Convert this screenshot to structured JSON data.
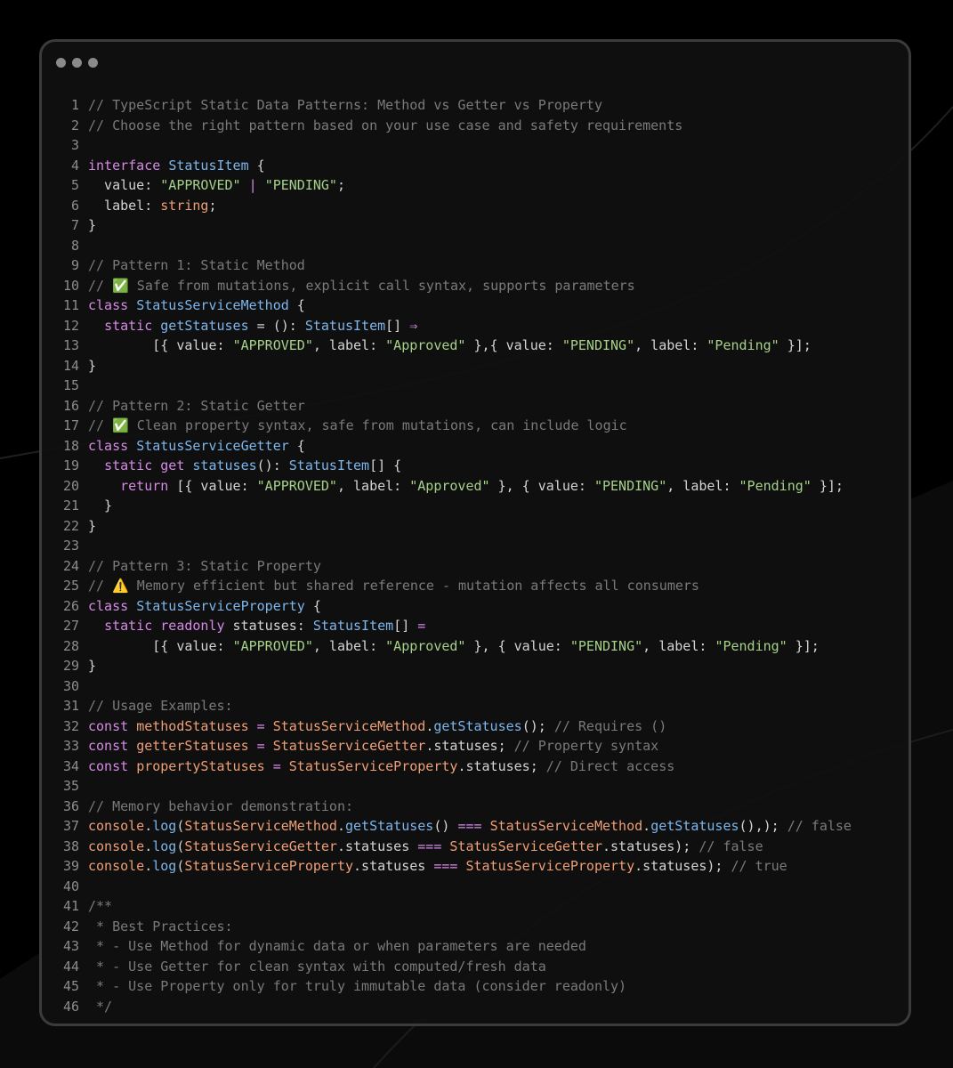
{
  "window": {
    "controls": [
      "close",
      "minimize",
      "maximize"
    ]
  },
  "colors": {
    "comment": "#7a7a7a",
    "keyword": "#d68ae6",
    "type": "#7cb6ec",
    "string": "#a6d189",
    "variable": "#ef9f76",
    "text": "#d4d4d4"
  },
  "code": {
    "lines": [
      {
        "n": "1",
        "t": [
          [
            "comment",
            "// TypeScript Static Data Patterns: Method vs Getter vs Property"
          ]
        ]
      },
      {
        "n": "2",
        "t": [
          [
            "comment",
            "// Choose the right pattern based on your use case and safety requirements"
          ]
        ]
      },
      {
        "n": "3",
        "t": []
      },
      {
        "n": "4",
        "t": [
          [
            "kw",
            "interface"
          ],
          [
            "punc",
            " "
          ],
          [
            "type",
            "StatusItem"
          ],
          [
            "punc",
            " {"
          ]
        ]
      },
      {
        "n": "5",
        "t": [
          [
            "punc",
            "  value: "
          ],
          [
            "str",
            "\"APPROVED\""
          ],
          [
            "punc",
            " "
          ],
          [
            "op",
            "|"
          ],
          [
            "punc",
            " "
          ],
          [
            "str",
            "\"PENDING\""
          ],
          [
            "punc",
            ";"
          ]
        ]
      },
      {
        "n": "6",
        "t": [
          [
            "punc",
            "  label: "
          ],
          [
            "var",
            "string"
          ],
          [
            "punc",
            ";"
          ]
        ]
      },
      {
        "n": "7",
        "t": [
          [
            "punc",
            "}"
          ]
        ]
      },
      {
        "n": "8",
        "t": []
      },
      {
        "n": "9",
        "t": [
          [
            "comment",
            "// Pattern 1: Static Method"
          ]
        ]
      },
      {
        "n": "10",
        "t": [
          [
            "comment",
            "// ✅ Safe from mutations, explicit call syntax, supports parameters"
          ]
        ]
      },
      {
        "n": "11",
        "t": [
          [
            "kw",
            "class"
          ],
          [
            "punc",
            " "
          ],
          [
            "type",
            "StatusServiceMethod"
          ],
          [
            "punc",
            " {"
          ]
        ]
      },
      {
        "n": "12",
        "t": [
          [
            "punc",
            "  "
          ],
          [
            "kw",
            "static"
          ],
          [
            "punc",
            " "
          ],
          [
            "fn",
            "getStatuses"
          ],
          [
            "punc",
            " = (): "
          ],
          [
            "type",
            "StatusItem"
          ],
          [
            "punc",
            "[] "
          ],
          [
            "op",
            "⇒"
          ]
        ]
      },
      {
        "n": "13",
        "t": [
          [
            "punc",
            "        [{ value: "
          ],
          [
            "str",
            "\"APPROVED\""
          ],
          [
            "punc",
            ", label: "
          ],
          [
            "str",
            "\"Approved\""
          ],
          [
            "punc",
            " },{ value: "
          ],
          [
            "str",
            "\"PENDING\""
          ],
          [
            "punc",
            ", label: "
          ],
          [
            "str",
            "\"Pending\""
          ],
          [
            "punc",
            " }];"
          ]
        ]
      },
      {
        "n": "14",
        "t": [
          [
            "punc",
            "}"
          ]
        ]
      },
      {
        "n": "15",
        "t": []
      },
      {
        "n": "16",
        "t": [
          [
            "comment",
            "// Pattern 2: Static Getter"
          ]
        ]
      },
      {
        "n": "17",
        "t": [
          [
            "comment",
            "// ✅ Clean property syntax, safe from mutations, can include logic"
          ]
        ]
      },
      {
        "n": "18",
        "t": [
          [
            "kw",
            "class"
          ],
          [
            "punc",
            " "
          ],
          [
            "type",
            "StatusServiceGetter"
          ],
          [
            "punc",
            " {"
          ]
        ]
      },
      {
        "n": "19",
        "t": [
          [
            "punc",
            "  "
          ],
          [
            "kw",
            "static"
          ],
          [
            "punc",
            " "
          ],
          [
            "kw",
            "get"
          ],
          [
            "punc",
            " "
          ],
          [
            "fn",
            "statuses"
          ],
          [
            "punc",
            "(): "
          ],
          [
            "type",
            "StatusItem"
          ],
          [
            "punc",
            "[] {"
          ]
        ]
      },
      {
        "n": "20",
        "t": [
          [
            "punc",
            "    "
          ],
          [
            "kw",
            "return"
          ],
          [
            "punc",
            " [{ value: "
          ],
          [
            "str",
            "\"APPROVED\""
          ],
          [
            "punc",
            ", label: "
          ],
          [
            "str",
            "\"Approved\""
          ],
          [
            "punc",
            " }, { value: "
          ],
          [
            "str",
            "\"PENDING\""
          ],
          [
            "punc",
            ", label: "
          ],
          [
            "str",
            "\"Pending\""
          ],
          [
            "punc",
            " }];"
          ]
        ]
      },
      {
        "n": "21",
        "t": [
          [
            "punc",
            "  }"
          ]
        ]
      },
      {
        "n": "22",
        "t": [
          [
            "punc",
            "}"
          ]
        ]
      },
      {
        "n": "23",
        "t": []
      },
      {
        "n": "24",
        "t": [
          [
            "comment",
            "// Pattern 3: Static Property"
          ]
        ]
      },
      {
        "n": "25",
        "t": [
          [
            "comment",
            "// ⚠️ Memory efficient but shared reference - mutation affects all consumers"
          ]
        ]
      },
      {
        "n": "26",
        "t": [
          [
            "kw",
            "class"
          ],
          [
            "punc",
            " "
          ],
          [
            "type",
            "StatusServiceProperty"
          ],
          [
            "punc",
            " {"
          ]
        ]
      },
      {
        "n": "27",
        "t": [
          [
            "punc",
            "  "
          ],
          [
            "kw",
            "static"
          ],
          [
            "punc",
            " "
          ],
          [
            "kw",
            "readonly"
          ],
          [
            "punc",
            " statuses: "
          ],
          [
            "type",
            "StatusItem"
          ],
          [
            "punc",
            "[] "
          ],
          [
            "op",
            "="
          ]
        ]
      },
      {
        "n": "28",
        "t": [
          [
            "punc",
            "        [{ value: "
          ],
          [
            "str",
            "\"APPROVED\""
          ],
          [
            "punc",
            ", label: "
          ],
          [
            "str",
            "\"Approved\""
          ],
          [
            "punc",
            " }, { value: "
          ],
          [
            "str",
            "\"PENDING\""
          ],
          [
            "punc",
            ", label: "
          ],
          [
            "str",
            "\"Pending\""
          ],
          [
            "punc",
            " }];"
          ]
        ]
      },
      {
        "n": "29",
        "t": [
          [
            "punc",
            "}"
          ]
        ]
      },
      {
        "n": "30",
        "t": []
      },
      {
        "n": "31",
        "t": [
          [
            "comment",
            "// Usage Examples:"
          ]
        ]
      },
      {
        "n": "32",
        "t": [
          [
            "kw",
            "const"
          ],
          [
            "punc",
            " "
          ],
          [
            "var",
            "methodStatuses"
          ],
          [
            "punc",
            " "
          ],
          [
            "op",
            "="
          ],
          [
            "punc",
            " "
          ],
          [
            "var",
            "StatusServiceMethod"
          ],
          [
            "punc",
            "."
          ],
          [
            "fn",
            "getStatuses"
          ],
          [
            "punc",
            "(); "
          ],
          [
            "comment",
            "// Requires ()"
          ]
        ]
      },
      {
        "n": "33",
        "t": [
          [
            "kw",
            "const"
          ],
          [
            "punc",
            " "
          ],
          [
            "var",
            "getterStatuses"
          ],
          [
            "punc",
            " "
          ],
          [
            "op",
            "="
          ],
          [
            "punc",
            " "
          ],
          [
            "var",
            "StatusServiceGetter"
          ],
          [
            "punc",
            ".statuses; "
          ],
          [
            "comment",
            "// Property syntax"
          ]
        ]
      },
      {
        "n": "34",
        "t": [
          [
            "kw",
            "const"
          ],
          [
            "punc",
            " "
          ],
          [
            "var",
            "propertyStatuses"
          ],
          [
            "punc",
            " "
          ],
          [
            "op",
            "="
          ],
          [
            "punc",
            " "
          ],
          [
            "var",
            "StatusServiceProperty"
          ],
          [
            "punc",
            ".statuses; "
          ],
          [
            "comment",
            "// Direct access"
          ]
        ]
      },
      {
        "n": "35",
        "t": []
      },
      {
        "n": "36",
        "t": [
          [
            "comment",
            "// Memory behavior demonstration:"
          ]
        ]
      },
      {
        "n": "37",
        "t": [
          [
            "var",
            "console"
          ],
          [
            "punc",
            "."
          ],
          [
            "fn",
            "log"
          ],
          [
            "punc",
            "("
          ],
          [
            "var",
            "StatusServiceMethod"
          ],
          [
            "punc",
            "."
          ],
          [
            "fn",
            "getStatuses"
          ],
          [
            "punc",
            "() "
          ],
          [
            "op",
            "==="
          ],
          [
            "punc",
            " "
          ],
          [
            "var",
            "StatusServiceMethod"
          ],
          [
            "punc",
            "."
          ],
          [
            "fn",
            "getStatuses"
          ],
          [
            "punc",
            "(),); "
          ],
          [
            "comment",
            "// false"
          ]
        ]
      },
      {
        "n": "38",
        "t": [
          [
            "var",
            "console"
          ],
          [
            "punc",
            "."
          ],
          [
            "fn",
            "log"
          ],
          [
            "punc",
            "("
          ],
          [
            "var",
            "StatusServiceGetter"
          ],
          [
            "punc",
            ".statuses "
          ],
          [
            "op",
            "==="
          ],
          [
            "punc",
            " "
          ],
          [
            "var",
            "StatusServiceGetter"
          ],
          [
            "punc",
            ".statuses); "
          ],
          [
            "comment",
            "// false"
          ]
        ]
      },
      {
        "n": "39",
        "t": [
          [
            "var",
            "console"
          ],
          [
            "punc",
            "."
          ],
          [
            "fn",
            "log"
          ],
          [
            "punc",
            "("
          ],
          [
            "var",
            "StatusServiceProperty"
          ],
          [
            "punc",
            ".statuses "
          ],
          [
            "op",
            "==="
          ],
          [
            "punc",
            " "
          ],
          [
            "var",
            "StatusServiceProperty"
          ],
          [
            "punc",
            ".statuses); "
          ],
          [
            "comment",
            "// true"
          ]
        ]
      },
      {
        "n": "40",
        "t": []
      },
      {
        "n": "41",
        "t": [
          [
            "comment",
            "/**"
          ]
        ]
      },
      {
        "n": "42",
        "t": [
          [
            "comment",
            " * Best Practices:"
          ]
        ]
      },
      {
        "n": "43",
        "t": [
          [
            "comment",
            " * - Use Method for dynamic data or when parameters are needed"
          ]
        ]
      },
      {
        "n": "44",
        "t": [
          [
            "comment",
            " * - Use Getter for clean syntax with computed/fresh data"
          ]
        ]
      },
      {
        "n": "45",
        "t": [
          [
            "comment",
            " * - Use Property only for truly immutable data (consider readonly)"
          ]
        ]
      },
      {
        "n": "46",
        "t": [
          [
            "comment",
            " */"
          ]
        ]
      }
    ]
  }
}
